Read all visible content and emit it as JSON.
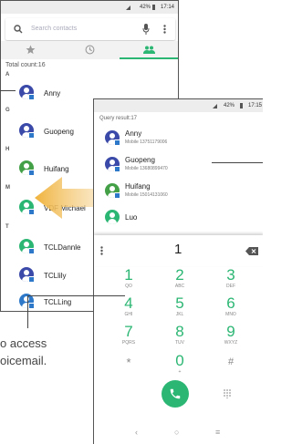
{
  "back_screen": {
    "status": {
      "battery": "42%",
      "time": "17:14"
    },
    "search": {
      "placeholder": "Search contacts"
    },
    "tabs": [
      {
        "icon": "star-icon"
      },
      {
        "icon": "clock-icon"
      },
      {
        "icon": "people-icon"
      }
    ],
    "total_count": "Total count:16",
    "contacts": [
      {
        "section": "A",
        "name": "Anny",
        "color": "#3b4aa8"
      },
      {
        "section": "G",
        "name": "Guopeng",
        "color": "#3b4aa8"
      },
      {
        "section": "H",
        "name": "Huifang",
        "color": "#43a047"
      },
      {
        "section": "M",
        "name": "VDF Michael",
        "color": "#2bb673"
      },
      {
        "section": "T",
        "name": "TCLDannle",
        "color": "#2bb673"
      },
      {
        "section": "",
        "name": "TCLlily",
        "color": "#3b4aa8"
      },
      {
        "section": "",
        "name": "TCLLing",
        "color": "#2d78c8"
      }
    ]
  },
  "front_screen": {
    "status": {
      "battery": "42%",
      "time": "17:15"
    },
    "query_result": "Query result:17",
    "results": [
      {
        "name": "Anny",
        "number": "Mobile 13751179006",
        "color": "#3b4aa8"
      },
      {
        "name": "Guopeng",
        "number": "Mobile 13680899470",
        "color": "#3b4aa8"
      },
      {
        "name": "Huifang",
        "number": "Mobile 15014131060",
        "color": "#43a047"
      },
      {
        "name": "Luo",
        "number": "",
        "color": "#2bb673"
      }
    ],
    "dial_input": "1",
    "keys": [
      {
        "digit": "1",
        "letters": "QO"
      },
      {
        "digit": "2",
        "letters": "ABC"
      },
      {
        "digit": "3",
        "letters": "DEF"
      },
      {
        "digit": "4",
        "letters": "GHI"
      },
      {
        "digit": "5",
        "letters": "JKL"
      },
      {
        "digit": "6",
        "letters": "MNO"
      },
      {
        "digit": "7",
        "letters": "PQRS"
      },
      {
        "digit": "8",
        "letters": "TUV"
      },
      {
        "digit": "9",
        "letters": "WXYZ"
      },
      {
        "digit": "*",
        "letters": ""
      },
      {
        "digit": "0",
        "letters": "+"
      },
      {
        "digit": "#",
        "letters": ""
      }
    ],
    "nav": {
      "back": "‹",
      "home": "○",
      "recents": "≡"
    }
  },
  "caption": {
    "line1": "o access",
    "line2": "oicemail."
  },
  "accent_color": "#2bb673"
}
